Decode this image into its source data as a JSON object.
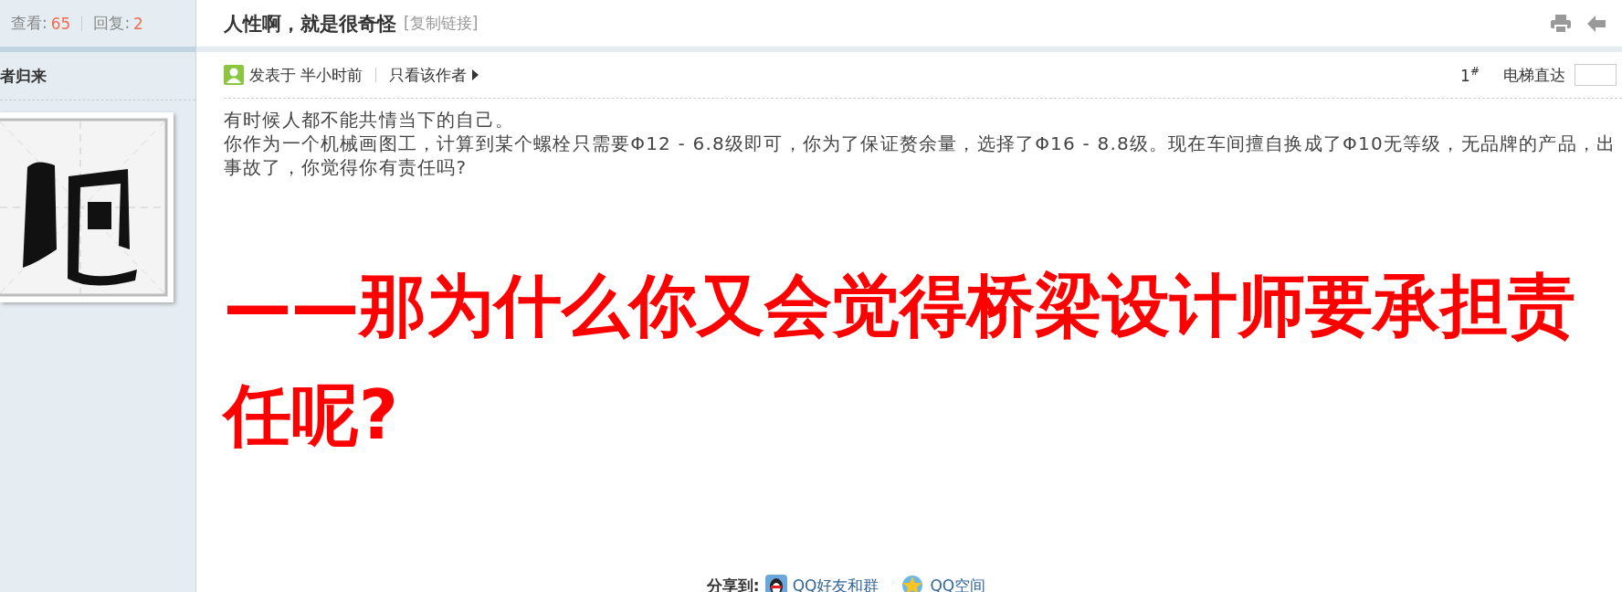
{
  "sidebar": {
    "stats": [
      {
        "label": "查看:",
        "value": "65"
      },
      {
        "label": "回复:",
        "value": "2"
      }
    ],
    "author": "者归来"
  },
  "thread": {
    "title": "人性啊，就是很奇怪",
    "copy_link": "[复制链接]"
  },
  "post": {
    "posted": "发表于 半小时前",
    "only_author": "只看该作者",
    "floor": "1",
    "floor_mark": "#",
    "jump_label": "电梯直达",
    "body_lines": [
      "有时候人都不能共情当下的自己。",
      "你作为一个机械画图工，计算到某个螺栓只需要Φ12 - 6.8级即可，你为了保证赘余量，选择了Φ16 - 8.8级。现在车间擅自换成了Φ10无等级，无品牌的产品，出",
      "事故了，你觉得你有责任吗?"
    ],
    "headline_lines": [
      "——那为什么你又会觉得桥梁设计师要承担责",
      "任呢?"
    ],
    "share": {
      "label": "分享到:",
      "links": [
        {
          "kind": "qq",
          "text": "QQ好友和群"
        },
        {
          "kind": "qzone",
          "text": "QQ空间"
        }
      ]
    }
  }
}
